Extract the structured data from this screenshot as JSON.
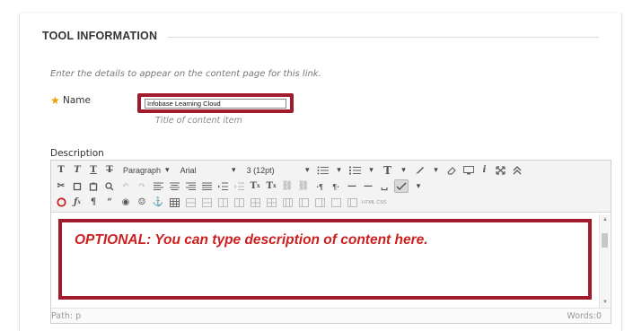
{
  "section": {
    "title": "TOOL INFORMATION"
  },
  "form": {
    "instructions": "Enter the details to appear on the content page for this link.",
    "required_mark": "★",
    "name_label": "Name",
    "name_value": "Infobase Learning Cloud",
    "name_hint": "Title of content item",
    "description_label": "Description"
  },
  "toolbar": {
    "row1": {
      "format_select": "Paragraph",
      "font_select": "Arial",
      "size_select": "3 (12pt)"
    },
    "html_css_label": "HTML CSS"
  },
  "editor": {
    "annotation": "OPTIONAL: You can type description of content here.",
    "path_label": "Path: p",
    "words_label": "Words:0"
  },
  "icons": {
    "required": "star-icon",
    "spellcheck": "spellcheck-icon",
    "math": "math-icon",
    "emoticon": "emoticon-icon"
  },
  "colors": {
    "highlight_outline": "#a01c2d",
    "annotation_text": "#cc1f1f",
    "required_star": "#e8a200"
  }
}
